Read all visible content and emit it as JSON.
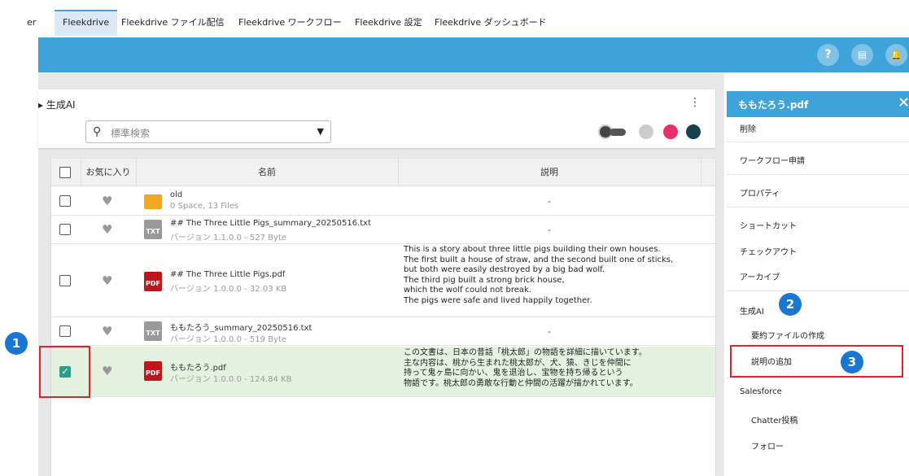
{
  "tabs": {
    "partial": "er",
    "items": [
      "Fleekdrive",
      "Fleekdrive ファイル配信",
      "Fleekdrive ワークフロー",
      "Fleekdrive 設定",
      "Fleekdrive ダッシュボード"
    ]
  },
  "toolbar": {
    "help": "?",
    "calendar": "▤",
    "bell": "🔔"
  },
  "breadcrumb": "▸ 生成AI",
  "kebab": "⋮",
  "search": {
    "placeholder": "標準検索"
  },
  "table": {
    "headers": [
      "お気に入り",
      "名前",
      "説明"
    ],
    "rows": [
      {
        "icon": "folder",
        "name": "old",
        "meta": "0 Space, 13 Files",
        "desc": [
          "-"
        ]
      },
      {
        "icon": "TXT",
        "name": "## The Three Little Pigs_summary_20250516.txt",
        "meta": "バージョン 1.1.0.0 - 527 Byte",
        "desc": [
          "-"
        ]
      },
      {
        "icon": "PDF",
        "name": "## The Three Little Pigs.pdf",
        "meta": "バージョン 1.0.0.0 - 32.03 KB",
        "desc": [
          "This is a story about three little pigs building their own houses.",
          "The first built a house of straw, and the second built one of sticks,",
          "but both were easily destroyed by a big bad wolf.",
          "The third pig built a strong brick house,",
          "which the wolf could not break.",
          "The pigs were safe and lived happily together."
        ]
      },
      {
        "icon": "TXT",
        "name": "ももたろう_summary_20250516.txt",
        "meta": "バージョン 1.0.0.0 - 519 Byte",
        "desc": [
          "-"
        ]
      },
      {
        "icon": "PDF",
        "name": "ももたろう.pdf",
        "meta": "バージョン 1.0.0.0 - 124.84 KB",
        "desc": [
          "この文書は、日本の昔話「桃太郎」の物語を詳細に描いています。",
          "主な内容は、桃から生まれた桃太郎が、犬、猿、きじを仲間に",
          "持って鬼ヶ島に向かい、鬼を退治し、宝物を持ち帰るという",
          "物語です。桃太郎の勇敢な行動と仲間の活躍が描かれています。"
        ]
      }
    ]
  },
  "right_panel": {
    "title": "ももたろう.pdf",
    "close": "✕",
    "items": [
      "削除",
      "ワークフロー申請",
      "プロパティ",
      "ショートカット",
      "チェックアウト",
      "アーカイブ",
      "生成AI",
      "要約ファイルの作成",
      "説明の追加",
      "Salesforce",
      "Chatter投稿",
      "フォロー"
    ]
  },
  "annotations": [
    "1",
    "2",
    "3"
  ],
  "colors": {
    "brand": "#3ea3d9",
    "highlight": "#e0242c",
    "selected_row": "#e3f3e0",
    "badge": "#1877d2"
  }
}
